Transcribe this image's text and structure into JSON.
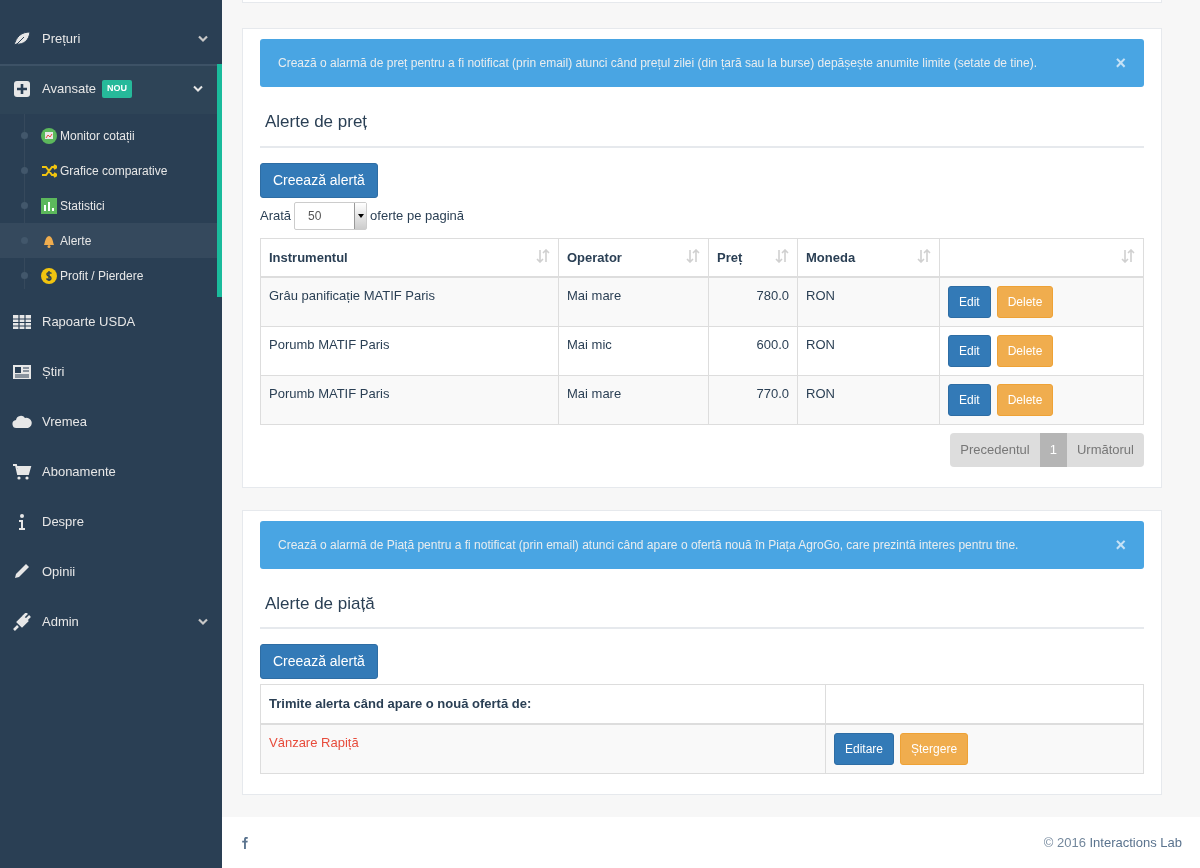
{
  "sidebar": {
    "items": [
      {
        "label": "Prețuri",
        "expanded": false,
        "has_submenu": true
      },
      {
        "label": "Avansate",
        "badge": "NOU",
        "expanded": true,
        "has_submenu": true,
        "children": [
          {
            "label": "Monitor cotații",
            "selected": false
          },
          {
            "label": "Grafice comparative",
            "selected": false
          },
          {
            "label": "Statistici",
            "selected": false
          },
          {
            "label": "Alerte",
            "selected": true
          },
          {
            "label": "Profit / Pierdere",
            "selected": false
          }
        ]
      },
      {
        "label": "Rapoarte USDA",
        "has_submenu": false
      },
      {
        "label": "Știri",
        "has_submenu": false
      },
      {
        "label": "Vremea",
        "has_submenu": false
      },
      {
        "label": "Abonamente",
        "has_submenu": false
      },
      {
        "label": "Despre",
        "has_submenu": false
      },
      {
        "label": "Opinii",
        "has_submenu": false
      },
      {
        "label": "Admin",
        "expanded": false,
        "has_submenu": true
      }
    ]
  },
  "price_alerts": {
    "info": "Crează o alarmă de preț pentru a fi notificat (prin email) atunci când prețul zilei (din țară sau la burse) depășește anumite limite (setate de tine).",
    "close": "×",
    "title": "Alerte de preț",
    "create_button": "Creează alertă",
    "length": {
      "before": "Arată",
      "value": "50",
      "after": "oferte pe pagină"
    },
    "columns": [
      "Instrumentul",
      "Operator",
      "Preț",
      "Moneda",
      ""
    ],
    "rows": [
      {
        "instrument": "Grâu panificație MATIF Paris",
        "operator": "Mai mare",
        "price": "780.0",
        "currency": "RON",
        "edit": "Edit",
        "delete": "Delete"
      },
      {
        "instrument": "Porumb MATIF Paris",
        "operator": "Mai mic",
        "price": "600.0",
        "currency": "RON",
        "edit": "Edit",
        "delete": "Delete"
      },
      {
        "instrument": "Porumb MATIF Paris",
        "operator": "Mai mare",
        "price": "770.0",
        "currency": "RON",
        "edit": "Edit",
        "delete": "Delete"
      }
    ],
    "pagination": {
      "previous": "Precedentul",
      "pages": [
        {
          "label": "1",
          "selected": true
        }
      ],
      "next": "Următorul",
      "disabled": true
    }
  },
  "market_alerts": {
    "info": "Crează o alarmă de Piață pentru a fi notificat (prin email) atunci când apare o ofertă nouă în Piața AgroGo, care prezintă interes pentru tine.",
    "close": "×",
    "title": "Alerte de piață",
    "create_button": "Creează alertă",
    "columns": [
      "Trimite alerta când apare o nouă ofertă de:",
      ""
    ],
    "rows": [
      {
        "offer": "Vânzare Rapiță",
        "edit": "Editare",
        "delete": "Ștergere"
      }
    ]
  },
  "footer": {
    "copyright": "© 2016",
    "link": "Interactions Lab"
  }
}
